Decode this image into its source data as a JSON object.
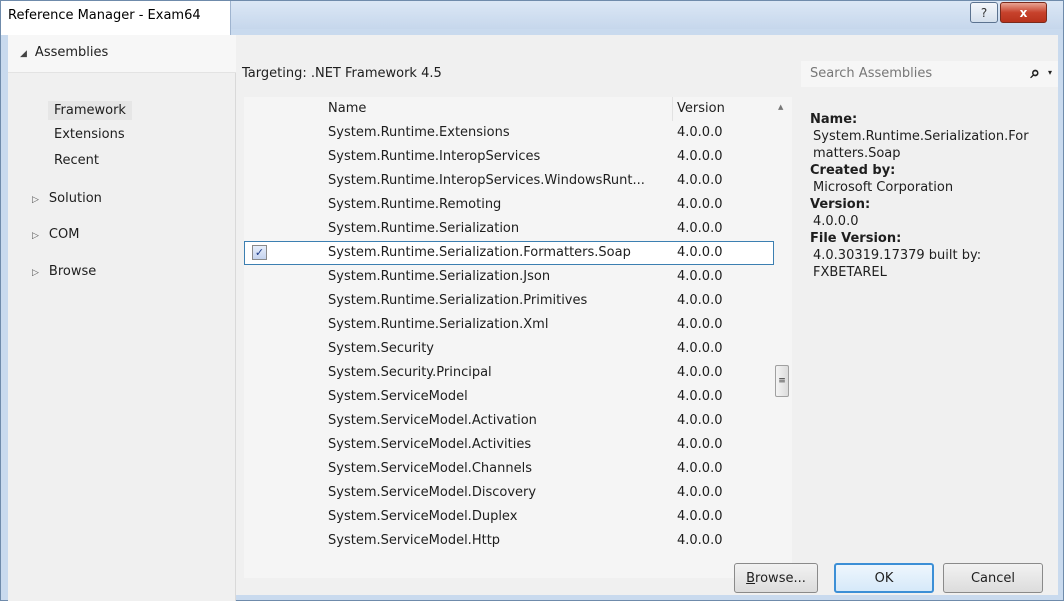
{
  "window": {
    "title": "Reference Manager - Exam64",
    "help_glyph": "?",
    "close_glyph": "x"
  },
  "nav": {
    "root": {
      "label": "Assemblies",
      "arrow": "◢"
    },
    "sub_items": [
      {
        "label": "Framework",
        "selected": true
      },
      {
        "label": "Extensions"
      },
      {
        "label": "Recent"
      }
    ],
    "groups": [
      {
        "label": "Solution",
        "arrow": "▷"
      },
      {
        "label": "COM",
        "arrow": "▷"
      },
      {
        "label": "Browse",
        "arrow": "▷"
      }
    ]
  },
  "targeting": "Targeting: .NET Framework 4.5",
  "search": {
    "placeholder": "Search Assemblies",
    "icon": "magnifier-icon",
    "dropdown_glyph": "▾"
  },
  "grid": {
    "columns": {
      "name": "Name",
      "version": "Version"
    },
    "rows": [
      {
        "name": "System.Runtime.Extensions",
        "version": "4.0.0.0"
      },
      {
        "name": "System.Runtime.InteropServices",
        "version": "4.0.0.0"
      },
      {
        "name": "System.Runtime.InteropServices.WindowsRunt...",
        "version": "4.0.0.0"
      },
      {
        "name": "System.Runtime.Remoting",
        "version": "4.0.0.0"
      },
      {
        "name": "System.Runtime.Serialization",
        "version": "4.0.0.0"
      },
      {
        "name": "System.Runtime.Serialization.Formatters.Soap",
        "version": "4.0.0.0",
        "checked": true,
        "selected": true
      },
      {
        "name": "System.Runtime.Serialization.Json",
        "version": "4.0.0.0"
      },
      {
        "name": "System.Runtime.Serialization.Primitives",
        "version": "4.0.0.0"
      },
      {
        "name": "System.Runtime.Serialization.Xml",
        "version": "4.0.0.0"
      },
      {
        "name": "System.Security",
        "version": "4.0.0.0"
      },
      {
        "name": "System.Security.Principal",
        "version": "4.0.0.0"
      },
      {
        "name": "System.ServiceModel",
        "version": "4.0.0.0"
      },
      {
        "name": "System.ServiceModel.Activation",
        "version": "4.0.0.0"
      },
      {
        "name": "System.ServiceModel.Activities",
        "version": "4.0.0.0"
      },
      {
        "name": "System.ServiceModel.Channels",
        "version": "4.0.0.0"
      },
      {
        "name": "System.ServiceModel.Discovery",
        "version": "4.0.0.0"
      },
      {
        "name": "System.ServiceModel.Duplex",
        "version": "4.0.0.0"
      },
      {
        "name": "System.ServiceModel.Http",
        "version": "4.0.0.0"
      }
    ],
    "check_glyph": "✓"
  },
  "scrollbar": {
    "up": "▲",
    "down": "▼",
    "thumb_glyph": "≡"
  },
  "details": {
    "name_label": "Name:",
    "name_value_1": "System.Runtime.Serialization.For",
    "name_value_2": "matters.Soap",
    "created_label": "Created by:",
    "created_value": "Microsoft Corporation",
    "version_label": "Version:",
    "version_value": "4.0.0.0",
    "file_version_label": "File Version:",
    "file_version_value_1": "4.0.30319.17379 built by:",
    "file_version_value_2": "FXBETAREL"
  },
  "buttons": {
    "browse_mnemonic": "B",
    "browse_rest": "rowse...",
    "ok": "OK",
    "cancel": "Cancel"
  }
}
